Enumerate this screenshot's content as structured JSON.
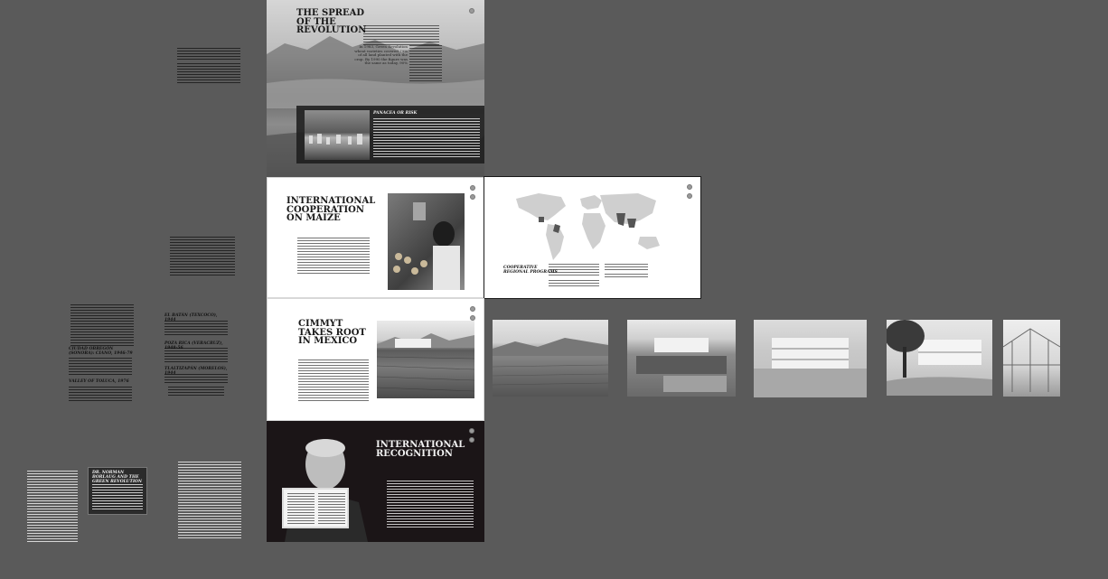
{
  "panels": {
    "spread": {
      "title_lines": [
        "THE SPREAD",
        "OF THE",
        "REVOLUTION"
      ],
      "callout": "In 1983, Green Revolution wheat varieties covered 79% of all land planted with the crop. By 1990 the figure was the same as today, 90%",
      "sidebar_title": "PANACEA OR RISK"
    },
    "maize": {
      "title_lines": [
        "INTERNATIONAL",
        "COOPERATION",
        "ON MAIZE"
      ]
    },
    "map": {
      "caption_lines": [
        "COOPERATIVE",
        "REGIONAL PROGRAMS"
      ]
    },
    "cimmyt": {
      "title_lines": [
        "CIMMYT",
        "TAKES ROOT",
        "IN MEXICO"
      ]
    },
    "recognition": {
      "title_lines": [
        "INTERNATIONAL",
        "RECOGNITION"
      ]
    }
  },
  "left_notes": {
    "sections": [
      "EL BATÁN (TEXCOCO), 1944",
      "POZA RICA (VERACRUZ), 1948-56",
      "TLALTIZAPÁN (MORELOS), 1944",
      "CIUDAD OBREGÓN (SONORA): CIANO, 1946-79",
      "VALLEY OF TOLUCA, 1976"
    ],
    "dark_box_title": "DR. NORMAN BORLAUG AND THE GREEN REVOLUTION"
  },
  "colors": {
    "canvas": "#5a5a5a",
    "panel_white": "#ffffff",
    "panel_dark": "#1b1517",
    "map_land": "#cfcfcf",
    "map_highlight": "#555555"
  }
}
